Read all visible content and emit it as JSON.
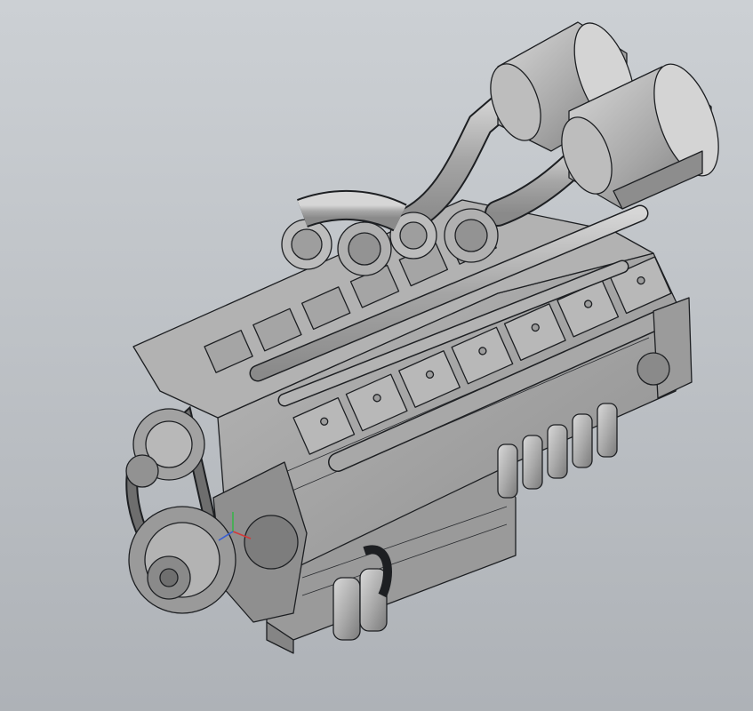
{
  "viewport": {
    "background_top": "#ccd0d4",
    "background_bottom": "#aeb2b7"
  },
  "model": {
    "fill_light": "#c9c9c9",
    "fill_mid": "#a9a9a9",
    "fill_dark": "#7e7e7e",
    "edge_color": "#1d1f22"
  },
  "triad": {
    "x_axis_color": "#d23a3a",
    "y_axis_color": "#38b44a",
    "z_axis_color": "#3a5fd2"
  }
}
